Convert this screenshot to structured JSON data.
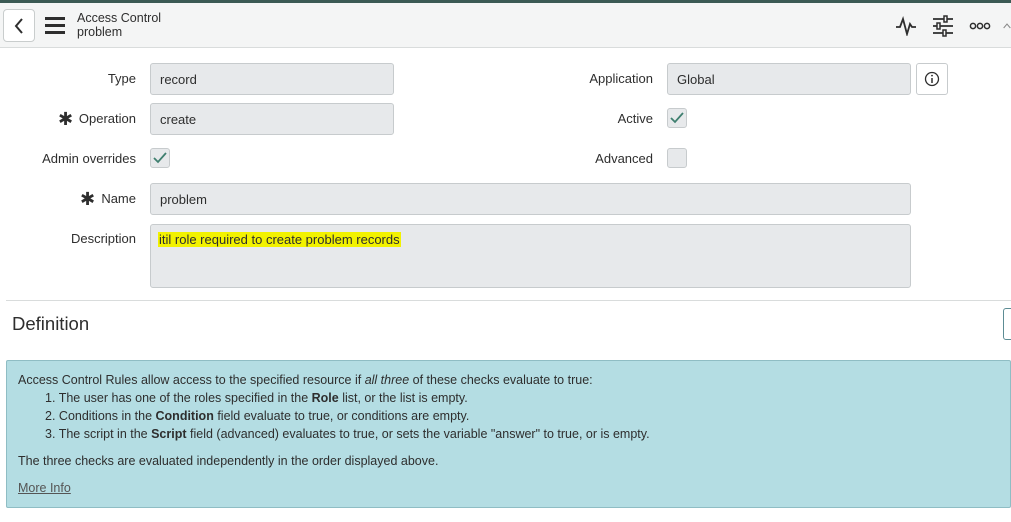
{
  "header": {
    "title": "Access Control",
    "subtitle": "problem",
    "icons": {
      "back": "chevron-left-icon",
      "menu": "hamburger-menu-icon",
      "activity": "activity-pulse-icon",
      "settings": "sliders-icon",
      "more": "more-options-icon"
    }
  },
  "form": {
    "type": {
      "label": "Type",
      "value": "record"
    },
    "operation": {
      "label": "Operation",
      "value": "create",
      "required_mark": "✱"
    },
    "admin_overrides": {
      "label": "Admin overrides",
      "checked": true
    },
    "name": {
      "label": "Name",
      "value": "problem",
      "required_mark": "✱"
    },
    "description": {
      "label": "Description",
      "value": "itil role required to create problem records"
    },
    "application": {
      "label": "Application",
      "value": "Global"
    },
    "active": {
      "label": "Active",
      "checked": true
    },
    "advanced": {
      "label": "Advanced",
      "checked": false
    }
  },
  "definition": {
    "title": "Definition",
    "intro_pre": "Access Control Rules allow access to the specified resource if ",
    "intro_em": "all three",
    "intro_post": " of these checks evaluate to true:",
    "items": [
      {
        "num": "1.",
        "pre": "The user has one of the roles specified in the ",
        "bold": "Role",
        "post": " list, or the list is empty."
      },
      {
        "num": "2.",
        "pre": "Conditions in the ",
        "bold": "Condition",
        "post": " field evaluate to true, or conditions are empty."
      },
      {
        "num": "3.",
        "pre": "The script in the ",
        "bold": "Script",
        "post": " field (advanced) evaluates to true, or sets the variable \"answer\" to true, or is empty."
      }
    ],
    "note": "The three checks are evaluated independently in the order displayed above.",
    "more_info": "More Info"
  },
  "colors": {
    "highlight": "#f2f200",
    "info_box": "#b4dde3",
    "header_bar": "#3b5a54"
  }
}
